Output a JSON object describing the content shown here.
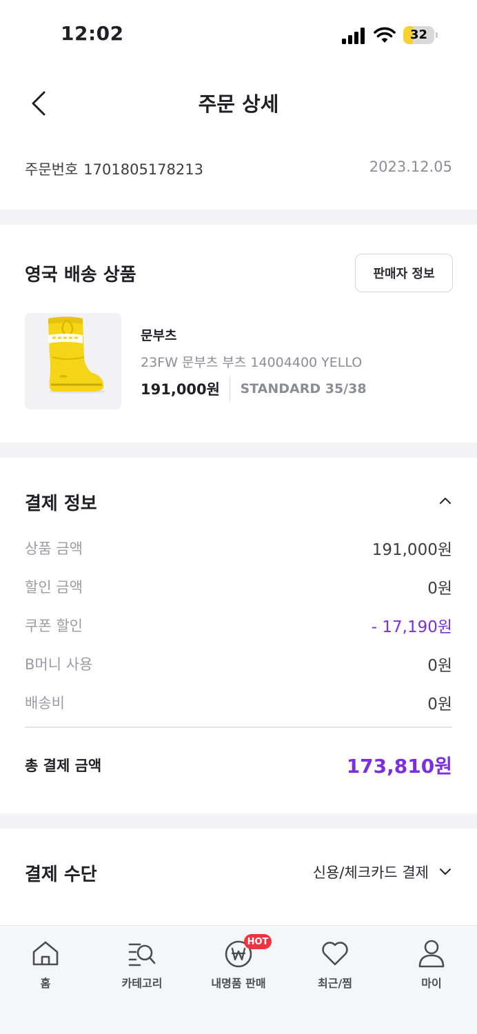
{
  "status_bar": {
    "time": "12:02",
    "battery_level": "32",
    "battery_fraction": 0.32
  },
  "header": {
    "title": "주문 상세",
    "back_icon": "chevron-left-icon"
  },
  "order": {
    "number_label": "주문번호",
    "number": "1701805178213",
    "date": "2023.12.05"
  },
  "product_section": {
    "title": "영국 배송 상품",
    "seller_button": "판매자 정보",
    "product": {
      "brand": "문부츠",
      "name": "23FW 문부츠 부츠 14004400 YELLO",
      "price": "191,000원",
      "option": "STANDARD 35/38",
      "image_icon": "yellow-snow-boot-image"
    }
  },
  "payment_info": {
    "title": "결제 정보",
    "rows": [
      {
        "label": "상품 금액",
        "value": "191,000원"
      },
      {
        "label": "할인 금액",
        "value": "0원"
      },
      {
        "label": "쿠폰 할인",
        "value": "- 17,190원"
      },
      {
        "label": "B머니 사용",
        "value": "0원"
      },
      {
        "label": "배송비",
        "value": "0원"
      }
    ],
    "total_label": "총 결제 금액",
    "total_value": "173,810원"
  },
  "payment_method": {
    "title": "결제 수단",
    "value": "신용/체크카드 결제"
  },
  "bottom_nav": {
    "items": [
      {
        "label": "홈",
        "icon": "home-icon"
      },
      {
        "label": "카테고리",
        "icon": "category-search-icon"
      },
      {
        "label": "내명품 판매",
        "icon": "won-coin-icon"
      },
      {
        "label": "최근/찜",
        "icon": "heart-icon"
      },
      {
        "label": "마이",
        "icon": "person-icon"
      }
    ],
    "hot_badge": "HOT"
  },
  "colors": {
    "accent_purple": "#7a2fe0",
    "hot_red": "#ef3340",
    "battery_yellow": "#f7d330"
  }
}
